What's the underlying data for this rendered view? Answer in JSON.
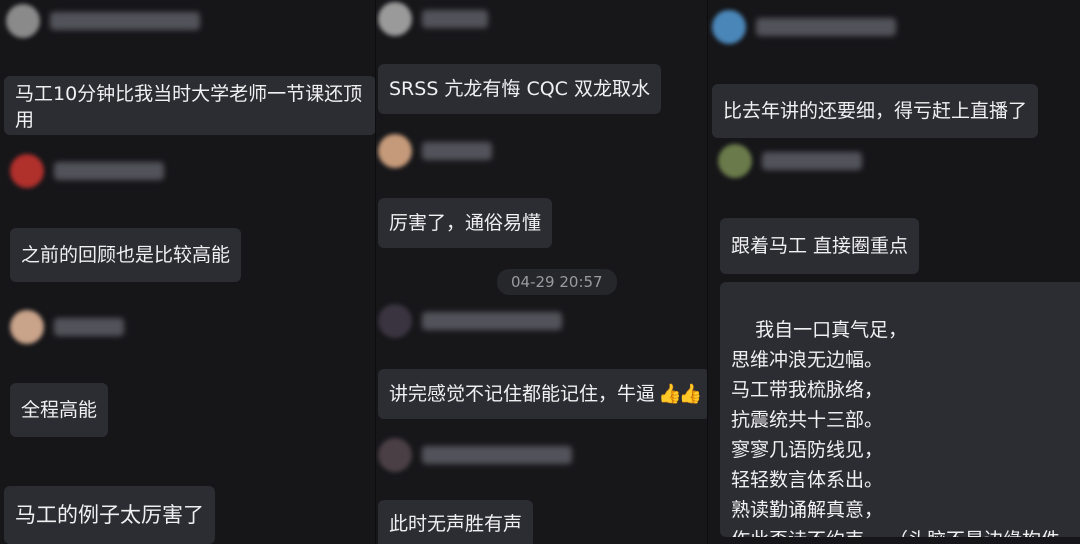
{
  "colors": {
    "background": "#161619",
    "bubble": "#2c2d32",
    "text": "#f0f0f3",
    "timestamp": "#9a9aa2"
  },
  "columns": [
    {
      "messages": [
        "马工10分钟比我当时大学老师一节课还顶用",
        "之前的回顾也是比较高能",
        "全程高能",
        "马工的例子太厉害了"
      ]
    },
    {
      "messages": [
        "SRSS 亢龙有悔 CQC 双龙取水",
        "厉害了，通俗易懂",
        "讲完感觉不记住都能记住，牛逼",
        "此时无声胜有声"
      ],
      "emoji": "👍👍",
      "timestamp": "04-29 20:57"
    },
    {
      "messages": [
        "比去年讲的还要细，得亏赶上直播了",
        "跟着马工 直接圈重点"
      ],
      "poem": "我自一口真气足，\n思维冲浪无边幅。\n马工带我梳脉络，\n抗震统共十三部。\n寥寥几语防线见，\n轻轻数言体系出。\n熟读勤诵解真意，\n作此歪诗不约束。 （头脑不是边缘构件"
    }
  ]
}
